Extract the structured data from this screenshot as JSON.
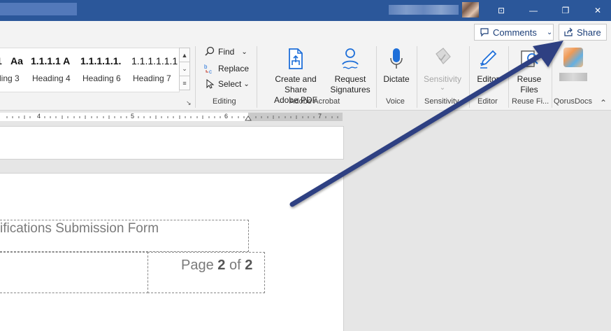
{
  "window": {
    "minimize_glyph": "—",
    "restore_glyph": "❐",
    "close_glyph": "✕",
    "ribbon_display_glyph": "⊡"
  },
  "toolbar": {
    "comments_label": "Comments",
    "share_label": "Share"
  },
  "styles": {
    "items": [
      {
        "preview": "1",
        "name": "ding 3"
      },
      {
        "preview": "Aa",
        "name": ""
      },
      {
        "preview": "1.1.1.1 A",
        "name": "Heading 4"
      },
      {
        "preview": "1.1.1.1.1.",
        "name": "Heading 6"
      },
      {
        "preview": "1.1.1.1.1.1.",
        "name": "Heading 7"
      }
    ]
  },
  "editing": {
    "find_label": "Find",
    "replace_label": "Replace",
    "select_label": "Select",
    "group_label": "Editing"
  },
  "acrobat": {
    "create_line1": "Create and Share",
    "create_line2": "Adobe PDF",
    "request_line1": "Request",
    "request_line2": "Signatures",
    "group_label": "Adobe Acrobat"
  },
  "voice": {
    "dictate_label": "Dictate",
    "group_label": "Voice"
  },
  "sensitivity": {
    "button_label": "Sensitivity",
    "group_label": "Sensitivity"
  },
  "editor": {
    "button_label": "Editor",
    "group_label": "Editor"
  },
  "reuse": {
    "line1": "Reuse",
    "line2": "Files",
    "group_label": "Reuse Fi..."
  },
  "qorus": {
    "group_label": "QorusDocs"
  },
  "ruler": {
    "numbers": [
      "4",
      "5",
      "6",
      "7"
    ]
  },
  "document": {
    "header_text": "ifications Submission Form",
    "page_prefix": "Page ",
    "page_current": "2",
    "page_of": " of ",
    "page_total": "2"
  },
  "colors": {
    "title_bar": "#2b579a",
    "arrow": "#2e3f82",
    "accent_text": "#1b3e78"
  }
}
